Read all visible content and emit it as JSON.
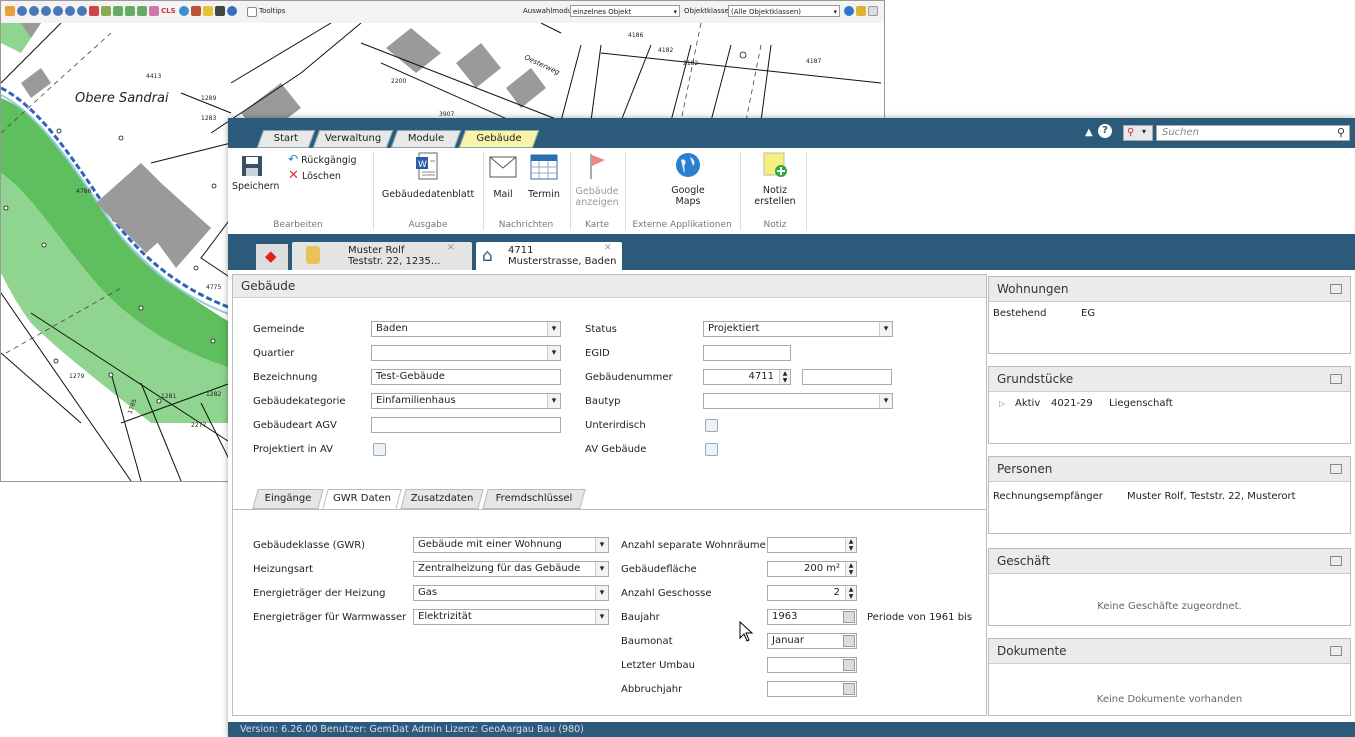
{
  "gis": {
    "tooltips_label": "Tooltips",
    "auswahlmodus_label": "Auswahlmodus:",
    "auswahlmodus_value": "einzelnes Objekt",
    "objektklasse_label": "Objektklasse:",
    "objektklasse_value": "(Alle Objektklassen)",
    "cls_label": "CLS",
    "map_labels": {
      "place": "Obere Sandrai",
      "parcels": [
        "4413",
        "1289",
        "2200",
        "3907",
        "4186",
        "4182",
        "2182",
        "4187",
        "4786",
        "4775",
        "1279",
        "1281",
        "1282",
        "1283",
        "2277",
        "1785"
      ],
      "street": "Oesterweg"
    }
  },
  "ribbon": {
    "tabs": [
      "Start",
      "Verwaltung",
      "Module",
      "Gebäude"
    ],
    "active_tab": "Gebäude",
    "search_placeholder": "Suchen",
    "buttons": {
      "speichern": "Speichern",
      "rueckgaengig": "Rückgängig",
      "loeschen": "Löschen",
      "gebaeudedatenblatt": "Gebäudedatenblatt",
      "mail": "Mail",
      "termin": "Termin",
      "gebaeude_anzeigen_1": "Gebäude",
      "gebaeude_anzeigen_2": "anzeigen",
      "google_1": "Google",
      "google_2": "Maps",
      "notiz_1": "Notiz",
      "notiz_2": "erstellen"
    },
    "groups": [
      "Bearbeiten",
      "Ausgabe",
      "Nachrichten",
      "Karte",
      "Externe Applikationen",
      "Notiz"
    ]
  },
  "doc_tabs": [
    {
      "line1": "Muster Rolf",
      "line2": "Teststr. 22, 1235..."
    },
    {
      "line1": "4711",
      "line2": "Musterstrasse, Baden"
    }
  ],
  "gebaeude": {
    "title": "Gebäude",
    "left_fields": [
      {
        "label": "Gemeinde",
        "value": "Baden",
        "type": "select"
      },
      {
        "label": "Quartier",
        "value": "",
        "type": "select"
      },
      {
        "label": "Bezeichnung",
        "value": "Test-Gebäude",
        "type": "text"
      },
      {
        "label": "Gebäudekategorie",
        "value": "Einfamilienhaus",
        "type": "select"
      },
      {
        "label": "Gebäudeart AGV",
        "value": "",
        "type": "text"
      },
      {
        "label": "Projektiert in AV",
        "value": "",
        "type": "check"
      }
    ],
    "right_fields": [
      {
        "label": "Status",
        "value": "Projektiert",
        "type": "select"
      },
      {
        "label": "EGID",
        "value": "",
        "type": "text"
      },
      {
        "label": "Gebäudenummer",
        "value": "4711",
        "type": "spin"
      },
      {
        "label": "Bautyp",
        "value": "",
        "type": "select"
      },
      {
        "label": "Unterirdisch",
        "value": "",
        "type": "check"
      },
      {
        "label": "AV Gebäude",
        "value": "",
        "type": "check"
      }
    ],
    "subtabs": [
      "Eingänge",
      "GWR Daten",
      "Zusatzdaten",
      "Fremdschlüssel"
    ],
    "active_subtab": "GWR Daten",
    "gwr_left": [
      {
        "label": "Gebäudeklasse (GWR)",
        "value": "Gebäude mit einer Wohnung"
      },
      {
        "label": "Heizungsart",
        "value": "Zentralheizung für das Gebäude"
      },
      {
        "label": "Energieträger der Heizung",
        "value": "Gas"
      },
      {
        "label": "Energieträger für Warmwasser",
        "value": "Elektrizität"
      }
    ],
    "gwr_right": [
      {
        "label": "Anzahl separate Wohnräume",
        "value": "",
        "type": "spin"
      },
      {
        "label": "Gebäudefläche",
        "value": "200 m²",
        "type": "spin"
      },
      {
        "label": "Anzahl Geschosse",
        "value": "2",
        "type": "spin"
      },
      {
        "label": "Baujahr",
        "value": "1963",
        "type": "cal"
      },
      {
        "label": "Baumonat",
        "value": "Januar",
        "type": "cal"
      },
      {
        "label": "Letzter Umbau",
        "value": "",
        "type": "cal"
      },
      {
        "label": "Abbruchjahr",
        "value": "",
        "type": "cal"
      }
    ],
    "periode_text": "Periode von 1961 bis"
  },
  "wohnungen": {
    "title": "Wohnungen",
    "row_status": "Bestehend",
    "row_value": "EG"
  },
  "grundstuecke": {
    "title": "Grundstücke",
    "status": "Aktiv",
    "nr": "4021-29",
    "type": "Liegenschaft"
  },
  "personen": {
    "title": "Personen",
    "role": "Rechnungsempfänger",
    "person": "Muster Rolf, Teststr. 22, Musterort"
  },
  "geschaeft": {
    "title": "Geschäft",
    "empty": "Keine Geschäfte zugeordnet."
  },
  "dokumente": {
    "title": "Dokumente",
    "empty": "Keine Dokumente vorhanden"
  },
  "status_bar": "Version: 6.26.00    Benutzer: GemDat Admin    Lizenz: GeoAargau Bau (980)"
}
